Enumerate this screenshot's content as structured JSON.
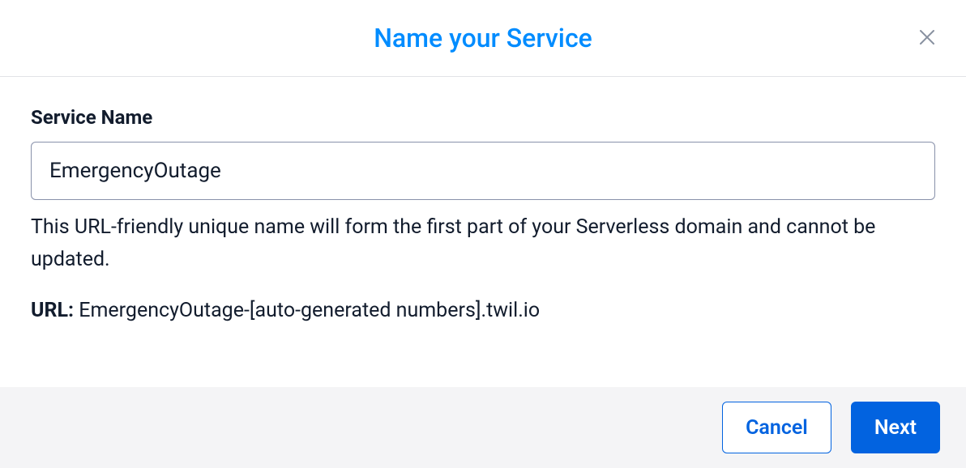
{
  "header": {
    "title": "Name your Service"
  },
  "body": {
    "field_label": "Service Name",
    "field_value": "EmergencyOutage",
    "hint": "This URL-friendly unique name will form the first part of your Serverless domain and cannot be updated.",
    "url_label": "URL:",
    "url_value": "EmergencyOutage-[auto-generated numbers].twil.io"
  },
  "footer": {
    "cancel_label": "Cancel",
    "next_label": "Next"
  }
}
